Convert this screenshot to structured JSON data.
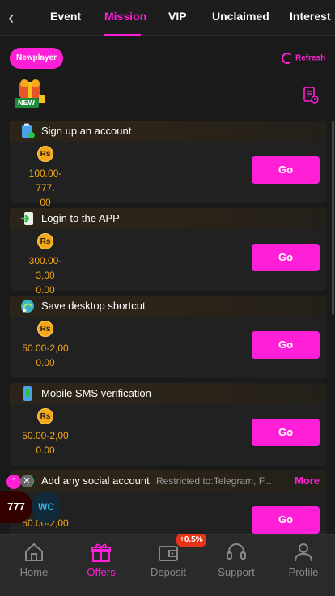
{
  "header": {
    "tabs": [
      {
        "label": "Event"
      },
      {
        "label": "Mission"
      },
      {
        "label": "VIP"
      },
      {
        "label": "Unclaimed"
      },
      {
        "label": "Interest"
      }
    ],
    "active_tab": "Mission"
  },
  "toolbar": {
    "newplayer_label": "Newplayer",
    "refresh_label": "Refresh",
    "new_badge": "NEW"
  },
  "missions": [
    {
      "title": "Sign up an account",
      "currency": "Rs",
      "reward_line1": "100.00-777.",
      "reward_line2": "00",
      "button": "Go"
    },
    {
      "title": "Login to the APP",
      "currency": "Rs",
      "reward_line1": "300.00-3,00",
      "reward_line2": "0.00",
      "button": "Go"
    },
    {
      "title": "Save desktop shortcut",
      "currency": "Rs",
      "reward_line1": "50.00-2,00",
      "reward_line2": "0.00",
      "button": "Go"
    },
    {
      "title": "Mobile SMS verification",
      "currency": "Rs",
      "reward_line1": "50.00-2,00",
      "reward_line2": "0.00",
      "button": "Go"
    },
    {
      "title": "Add any social account",
      "note": "Restricted to:Telegram, F...",
      "more": "More",
      "currency": "Rs",
      "reward_line1": "50.00-2,00",
      "reward_line2": "",
      "button": "Go"
    }
  ],
  "floating": {
    "game1": "777",
    "game2": "WC"
  },
  "bottom_nav": {
    "items": [
      {
        "label": "Home"
      },
      {
        "label": "Offers"
      },
      {
        "label": "Deposit"
      },
      {
        "label": "Support"
      },
      {
        "label": "Profile"
      }
    ],
    "active": "Offers",
    "deposit_badge": "+0.5%"
  },
  "colors": {
    "accent": "#ff1fd6",
    "reward": "#f5a81c",
    "background": "#1a1a1a"
  }
}
